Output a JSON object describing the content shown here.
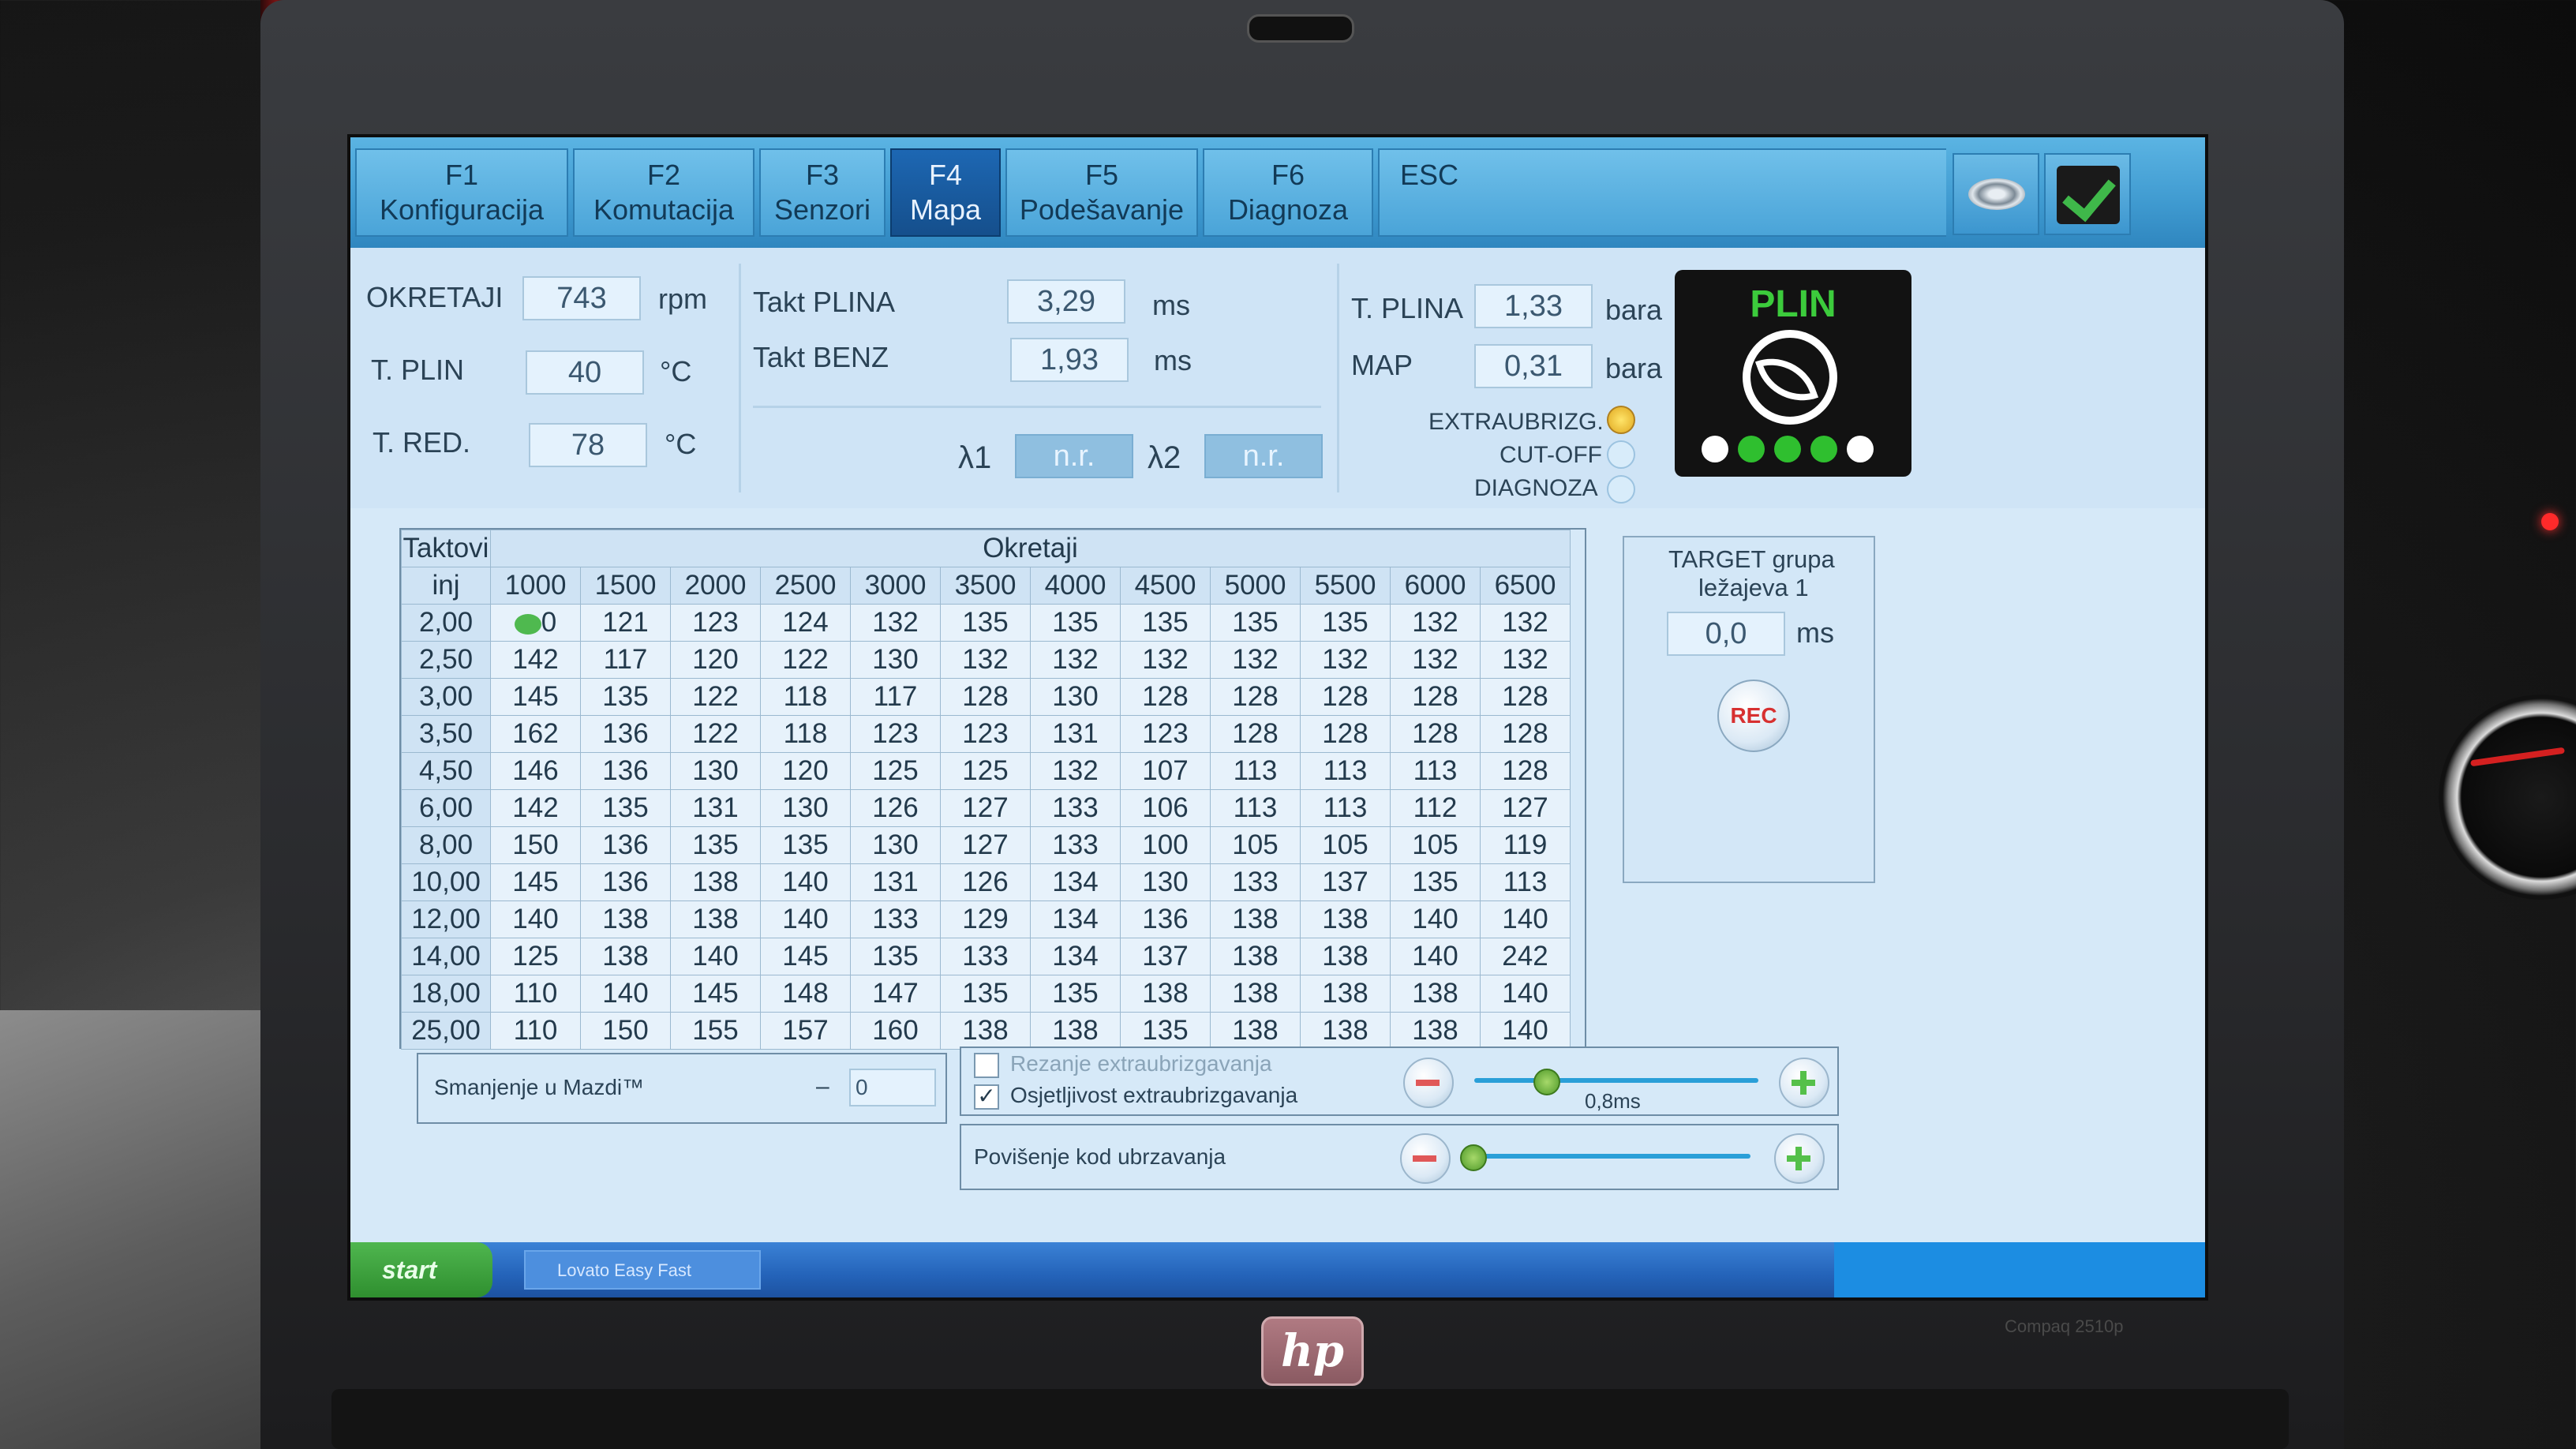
{
  "tabs": [
    {
      "key": "F1",
      "label": "Konfiguracija",
      "active": false
    },
    {
      "key": "F2",
      "label": "Komutacija",
      "active": false
    },
    {
      "key": "F3",
      "label": "Senzori",
      "active": false
    },
    {
      "key": "F4",
      "label": "Mapa",
      "active": true
    },
    {
      "key": "F5",
      "label": "Podešavanje",
      "active": false
    },
    {
      "key": "F6",
      "label": "Diagnoza",
      "active": false
    }
  ],
  "esc_label": "ESC",
  "icons": {
    "disc": "disc-icon",
    "check": "check-icon"
  },
  "readouts": {
    "okretaji": {
      "label": "OKRETAJI",
      "value": "743",
      "unit": "rpm"
    },
    "t_plin": {
      "label": "T. PLIN",
      "value": "40",
      "unit": "°C"
    },
    "t_red": {
      "label": "T. RED.",
      "value": "78",
      "unit": "°C"
    },
    "takt_plina": {
      "label": "Takt PLINA",
      "value": "3,29",
      "unit": "ms"
    },
    "takt_benz": {
      "label": "Takt BENZ",
      "value": "1,93",
      "unit": "ms"
    },
    "lambda1": {
      "label": "λ1",
      "value": "n.r."
    },
    "lambda2": {
      "label": "λ2",
      "value": "n.r."
    },
    "t_plina": {
      "label": "T. PLINA",
      "value": "1,33",
      "unit": "bara"
    },
    "map": {
      "label": "MAP",
      "value": "0,31",
      "unit": "bara"
    }
  },
  "status": {
    "extraubrizg": "EXTRAUBRIZG.",
    "cutoff": "CUT-OFF",
    "diagnoza": "DIAGNOZA"
  },
  "plin_badge": "PLIN",
  "map_table": {
    "corner_top": "Taktovi",
    "corner_bottom": "inj",
    "header_title": "Okretaji",
    "columns": [
      "1000",
      "1500",
      "2000",
      "2500",
      "3000",
      "3500",
      "4000",
      "4500",
      "5000",
      "5500",
      "6000",
      "6500"
    ],
    "rows": [
      {
        "label": "2,00",
        "cells": [
          "0",
          "121",
          "123",
          "124",
          "132",
          "135",
          "135",
          "135",
          "135",
          "135",
          "132",
          "132"
        ]
      },
      {
        "label": "2,50",
        "cells": [
          "142",
          "117",
          "120",
          "122",
          "130",
          "132",
          "132",
          "132",
          "132",
          "132",
          "132",
          "132"
        ]
      },
      {
        "label": "3,00",
        "cells": [
          "145",
          "135",
          "122",
          "118",
          "117",
          "128",
          "130",
          "128",
          "128",
          "128",
          "128",
          "128"
        ]
      },
      {
        "label": "3,50",
        "cells": [
          "162",
          "136",
          "122",
          "118",
          "123",
          "123",
          "131",
          "123",
          "128",
          "128",
          "128",
          "128"
        ]
      },
      {
        "label": "4,50",
        "cells": [
          "146",
          "136",
          "130",
          "120",
          "125",
          "125",
          "132",
          "107",
          "113",
          "113",
          "113",
          "128"
        ]
      },
      {
        "label": "6,00",
        "cells": [
          "142",
          "135",
          "131",
          "130",
          "126",
          "127",
          "133",
          "106",
          "113",
          "113",
          "112",
          "127"
        ]
      },
      {
        "label": "8,00",
        "cells": [
          "150",
          "136",
          "135",
          "135",
          "130",
          "127",
          "133",
          "100",
          "105",
          "105",
          "105",
          "119"
        ]
      },
      {
        "label": "10,00",
        "cells": [
          "145",
          "136",
          "138",
          "140",
          "131",
          "126",
          "134",
          "130",
          "133",
          "137",
          "135",
          "113"
        ]
      },
      {
        "label": "12,00",
        "cells": [
          "140",
          "138",
          "138",
          "140",
          "133",
          "129",
          "134",
          "136",
          "138",
          "138",
          "140",
          "140"
        ]
      },
      {
        "label": "14,00",
        "cells": [
          "125",
          "138",
          "140",
          "145",
          "135",
          "133",
          "134",
          "137",
          "138",
          "138",
          "140",
          "242"
        ]
      },
      {
        "label": "18,00",
        "cells": [
          "110",
          "140",
          "145",
          "148",
          "147",
          "135",
          "135",
          "138",
          "138",
          "138",
          "138",
          "140"
        ]
      },
      {
        "label": "25,00",
        "cells": [
          "110",
          "150",
          "155",
          "157",
          "160",
          "138",
          "138",
          "135",
          "138",
          "138",
          "138",
          "140"
        ]
      }
    ]
  },
  "target": {
    "title_line1": "TARGET grupa",
    "title_line2": "ležajeva 1",
    "value": "0,0",
    "unit": "ms",
    "rec_label": "REC"
  },
  "controls": {
    "smanjenje_label": "Smanjenje u Mazdi™",
    "smanjenje_sign": "–",
    "smanjenje_value": "0",
    "rezanje_label": "Rezanje extraubrizgavanja",
    "rezanje_checked": false,
    "osjetljivost_label": "Osjetljivost extraubrizgavanja",
    "osjetljivost_checked": true,
    "osjetljivost_value_label": "0,8ms",
    "osjetljivost_level": 0.25,
    "povisenje_label": "Povišenje kod ubrzavanja",
    "povisenje_level": 0.02
  },
  "taskbar": {
    "start_label": "start",
    "app_label": "Lovato Easy Fast"
  },
  "laptop": {
    "brand": "hp",
    "model": "Compaq 2510p"
  }
}
